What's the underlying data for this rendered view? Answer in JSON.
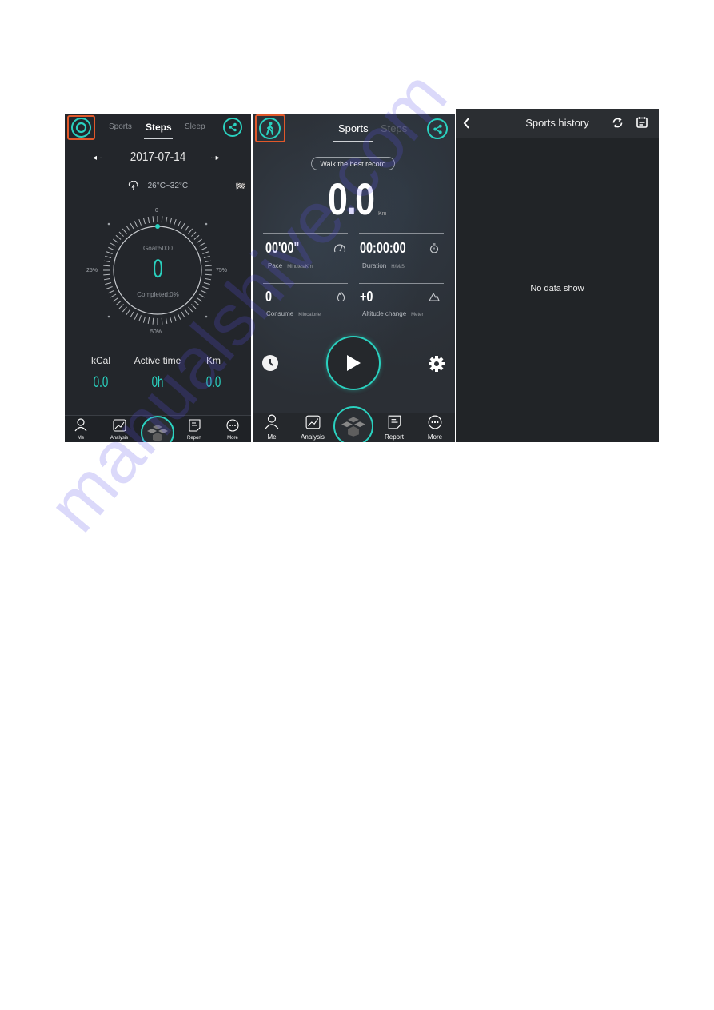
{
  "accent_color": "#2ad1bf",
  "highlight_color": "#e0582a",
  "watermark": "manualshive.com",
  "steps_screen": {
    "top_left_icon": "circle-target-icon",
    "tabs": [
      {
        "label": "Sports",
        "active": false
      },
      {
        "label": "Steps",
        "active": true
      },
      {
        "label": "Sleep",
        "active": false
      }
    ],
    "share_icon": "share-icon",
    "date": "2017-07-14",
    "prev_icon": "◂··",
    "next_icon": "··▸",
    "weather": "26°C~32°C",
    "weather_icon": "cloud-lightning-icon",
    "flag_icon": "checkered-flag-icon",
    "gauge": {
      "top_label": "0",
      "left_label": "25%",
      "bottom_label": "50%",
      "right_label": "75%",
      "goal_text": "Goal:5000",
      "steps": "0",
      "completed_text": "Completed:0%",
      "progress_fraction": 0
    },
    "stats": [
      {
        "label": "kCal",
        "value": "0.0"
      },
      {
        "label": "Active time",
        "value": "0h"
      },
      {
        "label": "Km",
        "value": "0.0"
      }
    ],
    "nav": [
      {
        "label": "Me",
        "icon": "person-icon"
      },
      {
        "label": "Analysis",
        "icon": "chart-icon"
      },
      {
        "label": "",
        "icon": "cube-logo-icon"
      },
      {
        "label": "Report",
        "icon": "report-icon"
      },
      {
        "label": "More",
        "icon": "more-icon"
      }
    ]
  },
  "sports_screen": {
    "top_left_icon": "walking-person-icon",
    "tabs": [
      {
        "label": "Sports",
        "active": true
      },
      {
        "label": "Steps",
        "active": false
      }
    ],
    "best_record_label": "Walk the best record",
    "distance": "0.0",
    "distance_unit": "Km",
    "metrics": [
      {
        "value": "00'00\"",
        "label": "Pace",
        "unit": "Minutes/Km",
        "icon": "speedometer-icon"
      },
      {
        "value": "00:00:00",
        "label": "Duration",
        "unit": "H/M/S",
        "icon": "stopwatch-icon"
      },
      {
        "value": "0",
        "label": "Consume",
        "unit": "Kilocalorie",
        "icon": "flame-icon"
      },
      {
        "value": "+0",
        "label": "Altitude change",
        "unit": "Meter",
        "icon": "mountain-icon"
      }
    ],
    "nav": [
      {
        "label": "Me"
      },
      {
        "label": "Analysis"
      },
      {
        "label": ""
      },
      {
        "label": "Report"
      },
      {
        "label": "More"
      }
    ]
  },
  "history_screen": {
    "title": "Sports history",
    "empty_text": "No data show"
  }
}
